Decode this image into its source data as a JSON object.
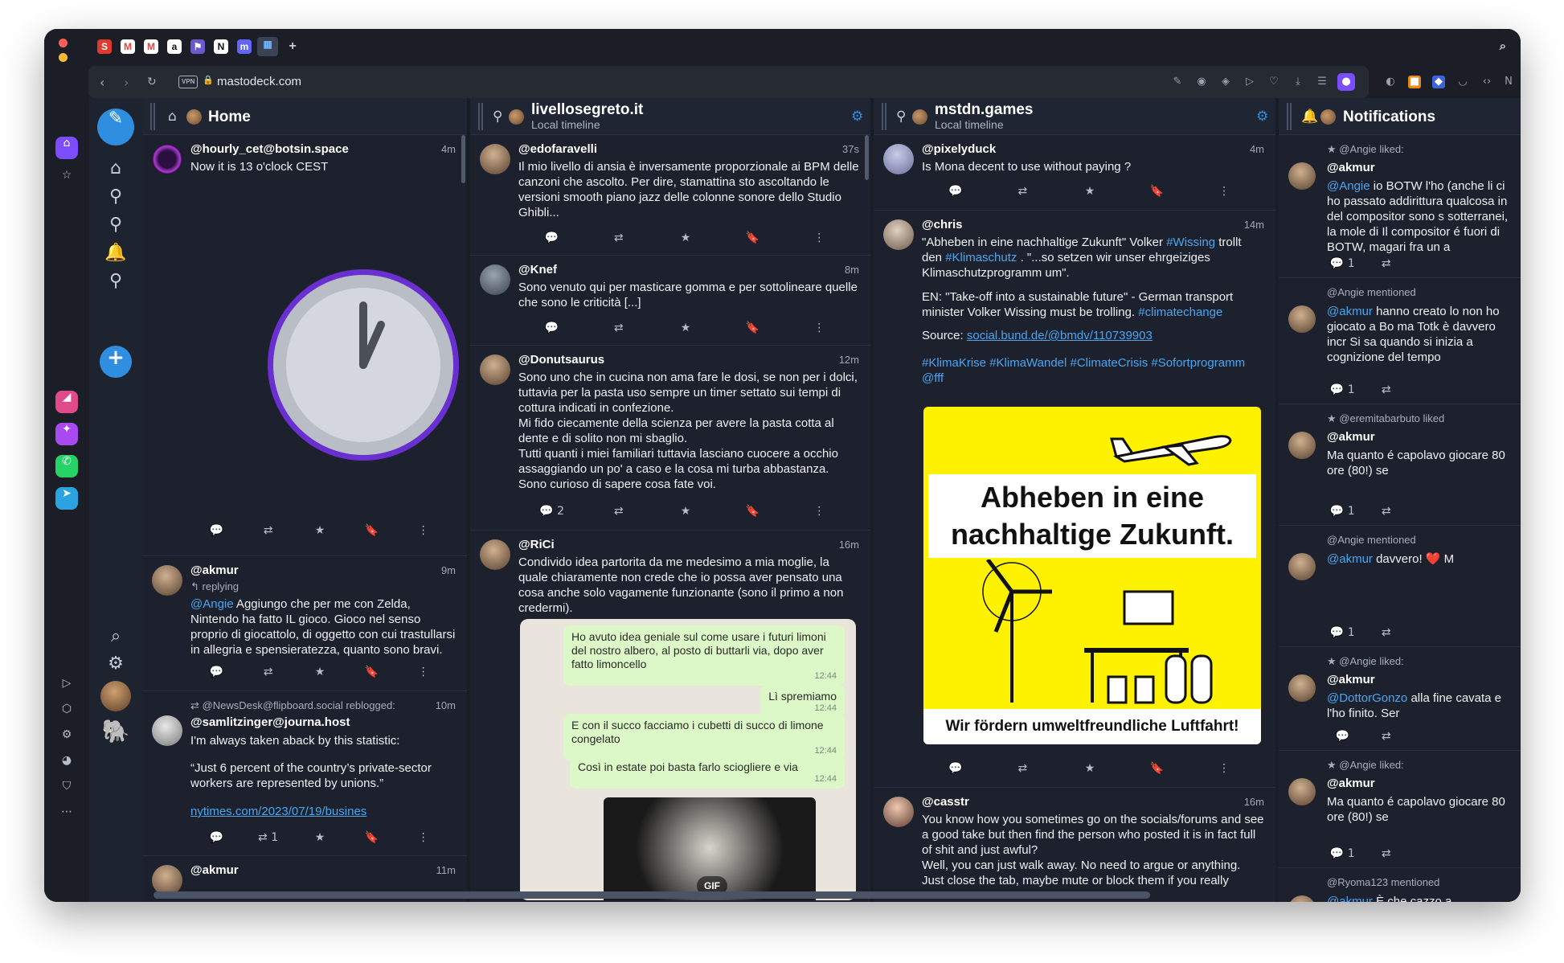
{
  "browser": {
    "url": "mastodeck.com",
    "vpn_label": "VPN"
  },
  "tabs": [
    "S",
    "M",
    "M",
    "a",
    "⚑",
    "N",
    "m",
    "▦"
  ],
  "nav": {
    "compose_icon": "pencil-icon",
    "items": [
      "home-icon",
      "location-pin-icon",
      "location-pin-icon",
      "bell-icon",
      "location-pin-icon"
    ],
    "add_label": "+"
  },
  "columns": {
    "home": {
      "title": "Home",
      "posts": [
        {
          "user": "@hourly_cet@botsin.space",
          "time": "4m",
          "text": "Now it is 13 o'clock CEST"
        },
        {
          "user": "@akmur",
          "time": "9m",
          "replying": "replying",
          "mention": "@Angie",
          "text": " Aggiungo che per me con Zelda, Nintendo ha fatto IL gioco. Gioco nel senso proprio di giocattolo, di oggetto con cui trastullarsi in allegria e spensieratezza, quanto sono bravi."
        },
        {
          "reblog": "@NewsDesk@flipboard.social reblogged:",
          "user": "@samlitzinger@journa.host",
          "time": "10m",
          "text1": "I'm always taken aback by this statistic:",
          "text2": "“Just 6 percent of the country’s private-sector workers are represented by unions.”",
          "link": "nytimes.com/2023/07/19/busines",
          "boosts": "1"
        },
        {
          "user": "@akmur",
          "time": "11m"
        }
      ]
    },
    "livello": {
      "title": "livellosegreto.it",
      "subtitle": "Local timeline",
      "posts": [
        {
          "user": "@edofaravelli",
          "time": "37s",
          "text": "Il mio livello di ansia è inversamente proporzionale ai BPM delle canzoni che ascolto. Per dire, stamattina sto ascoltando le versioni smooth piano jazz delle colonne sonore dello Studio Ghibli..."
        },
        {
          "user": "@Knef",
          "time": "8m",
          "text": "Sono venuto qui per masticare gomma e per sottolineare quelle che sono le criticità [...]"
        },
        {
          "user": "@Donutsaurus",
          "time": "12m",
          "text": "Sono uno che in cucina non ama fare le dosi, se non per i dolci, tuttavia per la pasta uso sempre un timer settato sui tempi di cottura indicati in confezione.\nMi fido ciecamente della scienza per avere la pasta cotta al dente e di solito non mi sbaglio.\nTutti quanti i miei familiari tuttavia lasciano cuocere a occhio assaggiando un po' a caso e la cosa mi turba abbastanza.\nSono curioso di sapere cosa fate voi.",
          "replies": "2"
        },
        {
          "user": "@RiCi",
          "time": "16m",
          "text": "Condivido idea partorita da me medesimo a mia moglie, la quale chiaramente non crede che io possa aver pensato una cosa anche solo vagamente funzionante (sono il primo a non credermi)."
        }
      ],
      "chat": [
        {
          "text": "Ho avuto idea geniale sul come usare i futuri limoni del nostro albero, al posto di buttarli via, dopo aver fatto limoncello",
          "time": "12:44"
        },
        {
          "text": "Lì spremiamo",
          "time": "12:44"
        },
        {
          "text": "E con il succo facciamo i cubetti di succo di limone congelato",
          "time": "12:44"
        },
        {
          "text": "Così in estate poi basta farlo sciogliere e via",
          "time": "12:44"
        }
      ],
      "gif_label": "GIF"
    },
    "mstdn": {
      "title": "mstdn.games",
      "subtitle": "Local timeline",
      "posts": [
        {
          "user": "@pixelyduck",
          "time": "4m",
          "text": "Is Mona decent to use without paying ?"
        },
        {
          "user": "@chris",
          "time": "14m",
          "p1a": "\"Abheben in eine nachhaltige Zukunft\" Volker ",
          "tag1": "#Wissing",
          "p1b": " trollt den ",
          "tag2": "#Klimaschutz",
          "p1c": " . \"...so setzen wir unser ehrgeiziges Klimaschutzprogramm um\".",
          "p2": "EN: \"Take-off into a sustainable future\" - German transport minister Volker Wissing must be trolling. ",
          "tag3": "#climatechange",
          "p3": "Source: ",
          "link": "social.bund.de/@bmdv/110739903",
          "tags": "#KlimaKrise #KlimaWandel #ClimateCrisis #Sofortprogramm @fff"
        },
        {
          "user": "@casstr",
          "time": "16m",
          "text": "You know how you sometimes go on the socials/forums and see a good take but then find the person who posted it is in fact full of shit and just awful?\nWell, you can just walk away. No need to argue or anything. Just close the tab, maybe mute or block them if you really"
        }
      ],
      "image": {
        "line1": "Abheben in eine",
        "line2": "nachhaltige Zukunft.",
        "footer": "Wir fördern umweltfreundliche Luftfahrt!"
      }
    },
    "notifications": {
      "title": "Notifications",
      "items": [
        {
          "meta": "@Angie liked:",
          "user": "@akmur",
          "mention": "@Angie",
          "text": " io BOTW l'ho (anche li ci ho passato addirittura qualcosa in del compositor sono s sotterranei, la mole di Il compositor é fuori di BOTW, magari fra un a",
          "replies": "1"
        },
        {
          "meta": "@Angie mentioned",
          "mention": "@akmur",
          "text": " hanno creato lo non ho giocato a Bo ma Totk è davvero incr Si sa quando si inizia a cognizione del tempo",
          "replies": "1"
        },
        {
          "meta": "@eremitabarbuto liked",
          "user": "@akmur",
          "text": "Ma quanto é capolavo giocare 80 ore (80!) se",
          "replies": "1"
        },
        {
          "meta": "@Angie mentioned",
          "mention": "@akmur",
          "text": " davvero! ❤️ M",
          "replies": "1"
        },
        {
          "meta": "@Angie liked:",
          "user": "@akmur",
          "mention": "@DottorGonzo",
          "text": " alla fine cavata e l'ho finito. Ser"
        },
        {
          "meta": "@Angie liked:",
          "user": "@akmur",
          "text": "Ma quanto é capolavo giocare 80 ore (80!) se",
          "replies": "1"
        },
        {
          "meta": "@Ryoma123 mentioned",
          "mention": "@akmur",
          "text": " È che cazzo a"
        }
      ]
    }
  },
  "colors": {
    "accent": "#2f8ee0",
    "opera_active": "#7c4dff",
    "bg": "#191d26"
  }
}
